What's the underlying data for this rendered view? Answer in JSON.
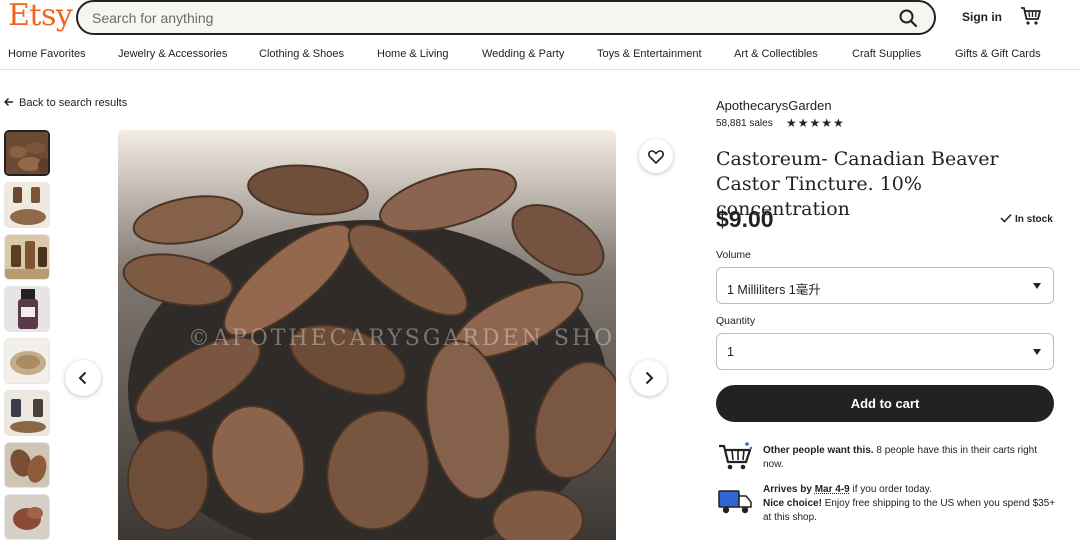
{
  "header": {
    "logo": "Etsy",
    "search_placeholder": "Search for anything",
    "signin": "Sign in"
  },
  "nav": [
    "Home Favorites",
    "Jewelry & Accessories",
    "Clothing & Shoes",
    "Home & Living",
    "Wedding & Party",
    "Toys & Entertainment",
    "Art & Collectibles",
    "Craft Supplies",
    "Gifts & Gift Cards"
  ],
  "back_link": "Back to search results",
  "gallery": {
    "watermark": "©APOTHECARYSGARDEN SHOP",
    "thumbnail_count": 8,
    "selected_index": 0
  },
  "shop": {
    "name": "ApothecarysGarden",
    "sales": "58,881 sales",
    "stars": "★★★★★"
  },
  "listing": {
    "title": "Castoreum- Canadian Beaver Castor Tincture. 10% concentration",
    "price": "$9.00",
    "stock": "In stock"
  },
  "options": {
    "volume_label": "Volume",
    "volume_value": "1 Milliliters 1毫升",
    "quantity_label": "Quantity",
    "quantity_value": "1"
  },
  "add_to_cart": "Add to cart",
  "info": {
    "demand_bold": "Other people want this.",
    "demand_text": " 8 people have this in their carts right now.",
    "arrives_bold": "Arrives by ",
    "arrives_date": "Mar 4-9",
    "arrives_text": " if you order today.",
    "nice_bold": "Nice choice!",
    "nice_text": " Enjoy free shipping to the US when you spend $35+ at this shop."
  },
  "colors": {
    "brand": "#f1641e",
    "dark": "#222222"
  }
}
